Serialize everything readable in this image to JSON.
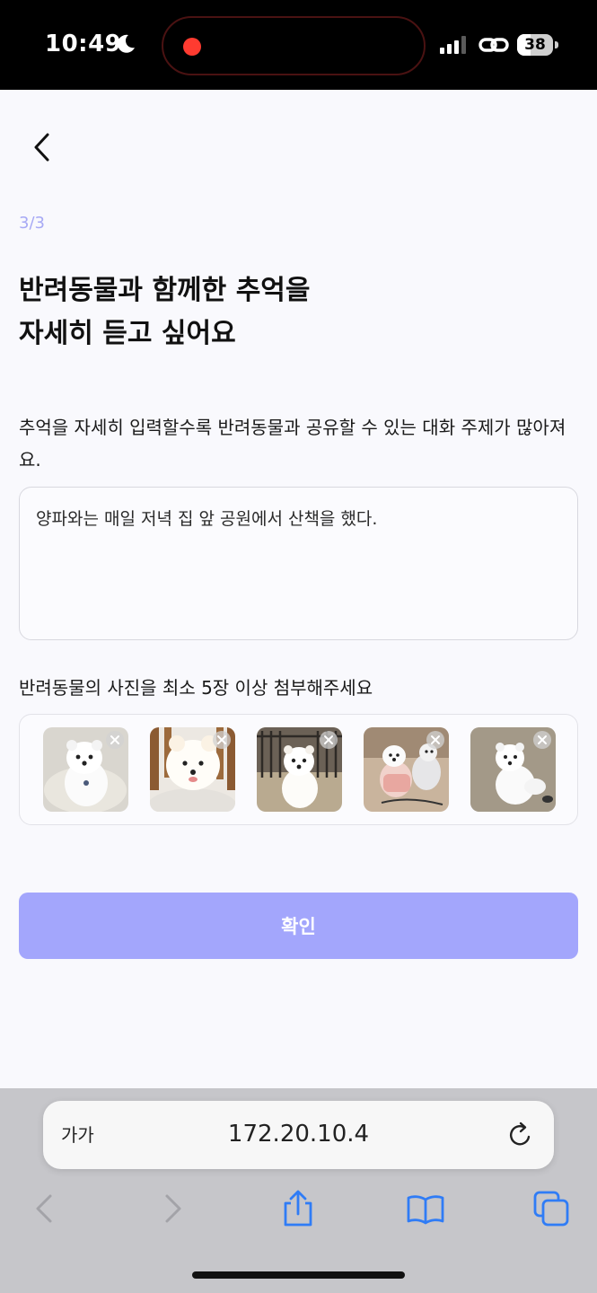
{
  "status_bar": {
    "time": "10:49",
    "battery": "38",
    "battery_level": 0.38,
    "icons": [
      "moon-icon",
      "recording-dot-icon",
      "signal-icon",
      "link-icon",
      "battery-icon"
    ]
  },
  "header": {
    "back_icon": "chevron-left-icon"
  },
  "main": {
    "step": "3/3",
    "title_line1": "반려동물과 함께한 추억을",
    "title_line2": "자세히 듣고 싶어요",
    "description": "추억을 자세히 입력할수록 반려동물과 공유할 수 있는 대화 주제가 많아져요.",
    "memory_input_value": "양파와는 매일 저녁 집 앞 공원에서 산책을 했다.",
    "photo_label": "반려동물의 사진을 최소 5장 이상 첨부해주세요",
    "photo_count": 5,
    "photo_remove_icon": "close-icon",
    "confirm_label": "확인"
  },
  "browser": {
    "text_size_label": "가가",
    "url": "172.20.10.4",
    "icons": [
      "reload-icon",
      "back-arrow-icon",
      "forward-arrow-icon",
      "share-icon",
      "bookmarks-icon",
      "tabs-icon"
    ]
  },
  "colors": {
    "accent": "#a3a6fc",
    "step_text": "#a7a9f5",
    "background": "#f9f9fd",
    "browser_blue": "#2f7cf6"
  }
}
